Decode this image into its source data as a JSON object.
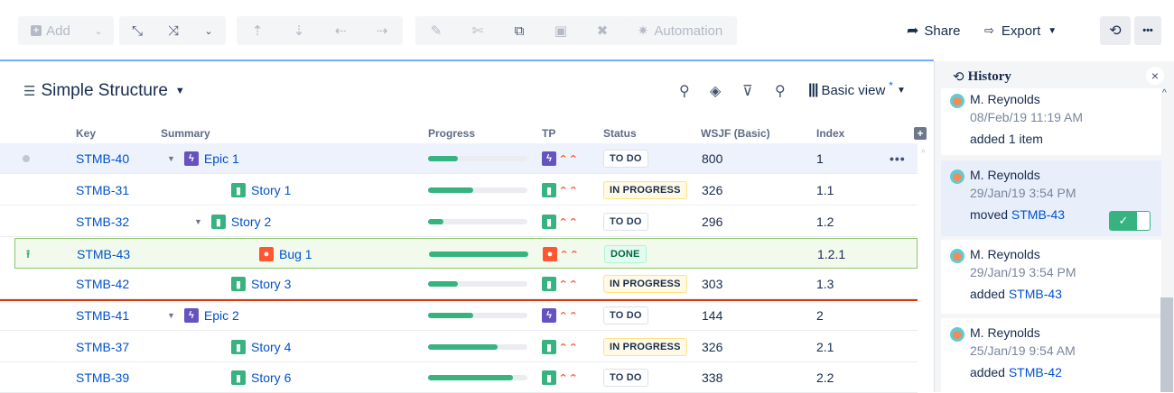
{
  "toolbar": {
    "add_label": "Add",
    "automation_label": "Automation",
    "share_label": "Share",
    "export_label": "Export",
    "more_label": "•••"
  },
  "structure": {
    "title": "Simple Structure",
    "view_label": "Basic view",
    "view_modified_mark": "*"
  },
  "columns": {
    "key": "Key",
    "summary": "Summary",
    "progress": "Progress",
    "tp": "TP",
    "status": "Status",
    "wsjf": "WSJF (Basic)",
    "index": "Index"
  },
  "rows": [
    {
      "key": "STMB-40",
      "summary": "Epic 1",
      "type": "epic",
      "progress": 0.3,
      "status": "TO DO",
      "wsjf": "800",
      "index": "1"
    },
    {
      "key": "STMB-31",
      "summary": "Story 1",
      "type": "story",
      "progress": 0.45,
      "status": "IN PROGRESS",
      "wsjf": "326",
      "index": "1.1"
    },
    {
      "key": "STMB-32",
      "summary": "Story 2",
      "type": "story",
      "progress": 0.15,
      "status": "TO DO",
      "wsjf": "296",
      "index": "1.2"
    },
    {
      "key": "STMB-43",
      "summary": "Bug 1",
      "type": "bug",
      "progress": 1.0,
      "status": "DONE",
      "wsjf": "",
      "index": "1.2.1"
    },
    {
      "key": "STMB-42",
      "summary": "Story 3",
      "type": "story",
      "progress": 0.3,
      "status": "IN PROGRESS",
      "wsjf": "303",
      "index": "1.3"
    },
    {
      "key": "STMB-41",
      "summary": "Epic 2",
      "type": "epic",
      "progress": 0.45,
      "status": "TO DO",
      "wsjf": "144",
      "index": "2"
    },
    {
      "key": "STMB-37",
      "summary": "Story 4",
      "type": "story",
      "progress": 0.7,
      "status": "IN PROGRESS",
      "wsjf": "326",
      "index": "2.1"
    },
    {
      "key": "STMB-39",
      "summary": "Story 6",
      "type": "story",
      "progress": 0.85,
      "status": "TO DO",
      "wsjf": "338",
      "index": "2.2"
    }
  ],
  "history": {
    "title": "History",
    "entries": [
      {
        "user": "M. Reynolds",
        "date": "08/Feb/19 11:19 AM",
        "action": "added 1 item",
        "link": ""
      },
      {
        "user": "M. Reynolds",
        "date": "29/Jan/19 3:54 PM",
        "action": "moved",
        "link": "STMB-43"
      },
      {
        "user": "M. Reynolds",
        "date": "29/Jan/19 3:54 PM",
        "action": "added",
        "link": "STMB-43"
      },
      {
        "user": "M. Reynolds",
        "date": "25/Jan/19 9:54 AM",
        "action": "added",
        "link": "STMB-42"
      }
    ]
  },
  "colors": {
    "accent": "#0052cc",
    "epic": "#6554c0",
    "story": "#36b37e",
    "bug": "#ff5630",
    "drop_line": "#de350b"
  }
}
